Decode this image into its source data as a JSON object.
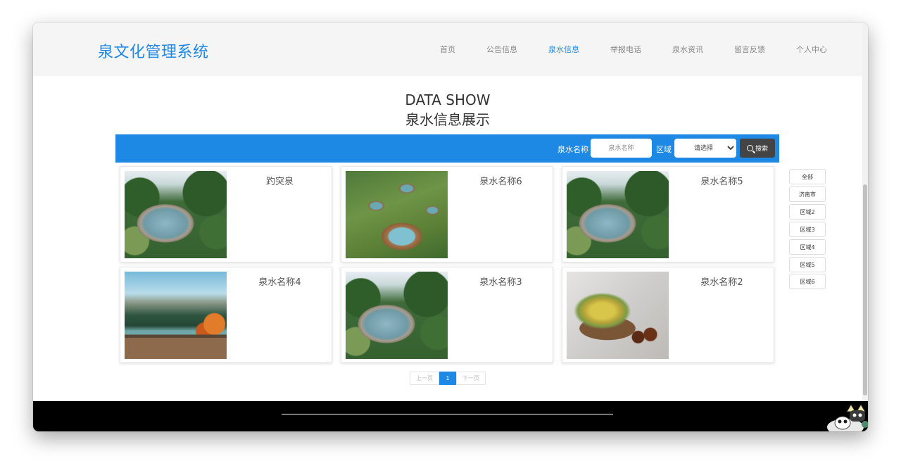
{
  "header": {
    "logo": "泉文化管理系统",
    "nav": [
      {
        "label": "首页"
      },
      {
        "label": "公告信息"
      },
      {
        "label": "泉水信息"
      },
      {
        "label": "举报电话"
      },
      {
        "label": "泉水资讯"
      },
      {
        "label": "留言反馈"
      },
      {
        "label": "个人中心"
      }
    ],
    "active_nav": "泉水信息"
  },
  "page": {
    "title_en": "DATA SHOW",
    "title_cn": "泉水信息展示"
  },
  "search": {
    "name_label": "泉水名称",
    "name_placeholder": "泉水名称",
    "area_label": "区域",
    "area_selected": "请选择",
    "button_label": "搜索"
  },
  "springs": [
    {
      "name": "趵突泉",
      "image": "stone-pool-garden"
    },
    {
      "name": "泉水名称6",
      "image": "clay-jar-pools"
    },
    {
      "name": "泉水名称5",
      "image": "stone-pool-garden"
    },
    {
      "name": "泉水名称4",
      "image": "mountain-lake-deck"
    },
    {
      "name": "泉水名称3",
      "image": "stone-pool-garden"
    },
    {
      "name": "泉水名称2",
      "image": "flowers-and-bottles"
    }
  ],
  "filters": [
    "全部",
    "济南市",
    "区域2",
    "区域3",
    "区域4",
    "区域5",
    "区域6"
  ],
  "pagination": {
    "prev": "上一页",
    "current": "1",
    "next": "下一页"
  },
  "colors": {
    "accent": "#1e88e5",
    "header_bg": "#f5f5f5",
    "footer_bg": "#000000",
    "search_button": "#444444"
  }
}
